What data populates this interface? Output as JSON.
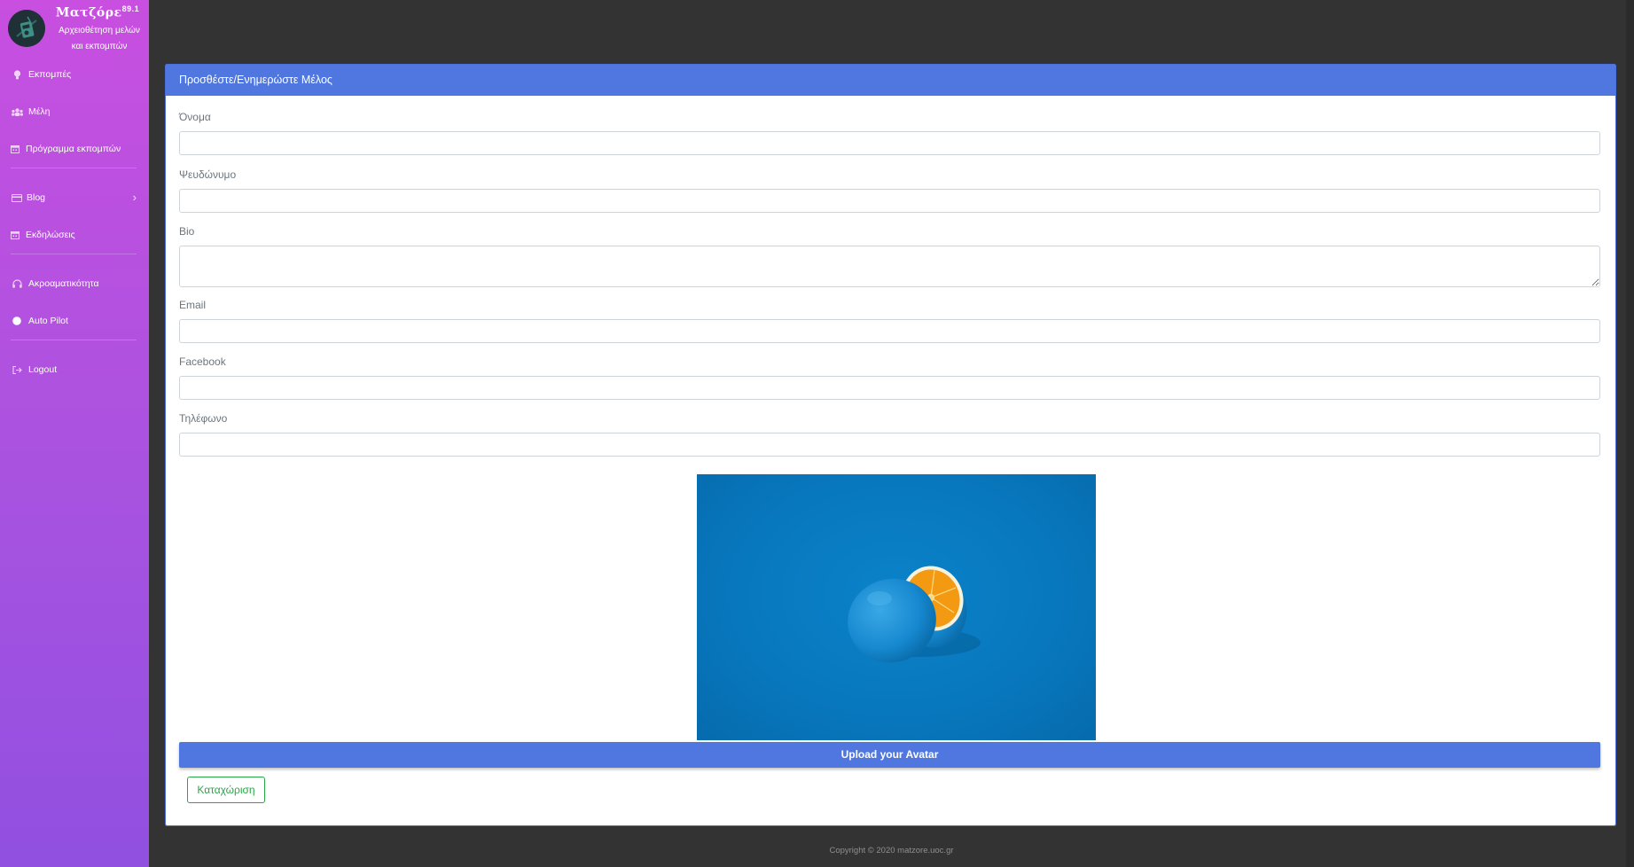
{
  "brand": {
    "name": "Ματζόρε",
    "frequency": "89.1",
    "subtitle_line1": "Αρχειοθέτηση μελών",
    "subtitle_line2": "και εκπομπών"
  },
  "sidebar": {
    "items": [
      {
        "label": "Εκπομπές",
        "icon": "lightbulb-icon"
      },
      {
        "label": "Μέλη",
        "icon": "users-icon"
      },
      {
        "label": "Πρόγραμμα εκπομπών",
        "icon": "calendar-icon"
      },
      {
        "label": "Blog",
        "icon": "card-icon",
        "has_submenu": true
      },
      {
        "label": "Εκδηλώσεις",
        "icon": "calendar-icon"
      },
      {
        "label": "Ακροαματικότητα",
        "icon": "headphones-icon"
      },
      {
        "label": "Auto Pilot",
        "icon": "circle-icon"
      },
      {
        "label": "Logout",
        "icon": "sign-out-icon"
      }
    ]
  },
  "card": {
    "title": "Προσθέστε/Ενημερώστε Μέλος"
  },
  "form": {
    "name_label": "Όνομα",
    "name_value": "",
    "alias_label": "Ψευδώνυμο",
    "alias_value": "",
    "bio_label": "Bio",
    "bio_value": "",
    "email_label": "Email",
    "email_value": "",
    "facebook_label": "Facebook",
    "facebook_value": "",
    "phone_label": "Τηλέφωνο",
    "phone_value": "",
    "upload_label": "Upload your Avatar",
    "submit_label": "Καταχώριση"
  },
  "footer": {
    "copyright": "Copyright © 2020 matzore.uoc.gr"
  },
  "colors": {
    "sidebar_top": "#c84fe0",
    "sidebar_bottom": "#9150e0",
    "primary": "#5077e0",
    "success": "#28a745",
    "background": "#333333"
  }
}
